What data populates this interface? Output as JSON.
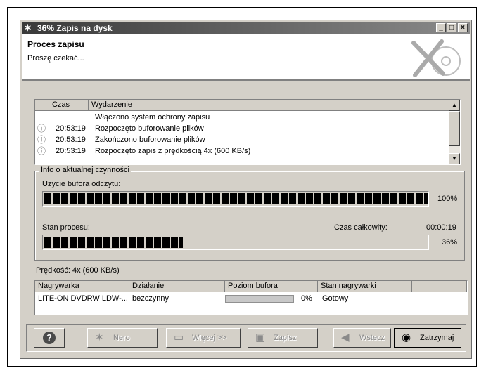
{
  "window": {
    "title": "36% Zapis na dysk",
    "buttons": {
      "minimize": "_",
      "maximize": "□",
      "close": "×"
    }
  },
  "header": {
    "heading": "Proces zapisu",
    "subtitle": "Proszę czekać..."
  },
  "log": {
    "columns": {
      "time": "Czas",
      "event": "Wydarzenie"
    },
    "rows": [
      {
        "icon": "",
        "time": "",
        "event": "Włączono system ochrony zapisu"
      },
      {
        "icon": "info-icon",
        "time": "20:53:19",
        "event": "Rozpoczęto buforowanie plików"
      },
      {
        "icon": "info-icon",
        "time": "20:53:19",
        "event": "Zakończono buforowanie plików"
      },
      {
        "icon": "info-icon",
        "time": "20:53:19",
        "event": "Rozpoczęto zapis z prędkością 4x (600 KB/s)"
      }
    ]
  },
  "activity": {
    "legend": "Info o aktualnej czynności",
    "buffer_label": "Użycie bufora odczytu:",
    "buffer_percent": "100%",
    "buffer_value": 1.0,
    "process_label": "Stan procesu:",
    "total_time_label": "Czas całkowity:",
    "total_time": "00:00:19",
    "process_percent": "36%",
    "process_value": 0.36
  },
  "speed": "Prędkość: 4x (600 KB/s)",
  "devices": {
    "columns": {
      "recorder": "Nagrywarka",
      "action": "Działanie",
      "buffer": "Poziom bufora",
      "status": "Stan nagrywarki"
    },
    "rows": [
      {
        "recorder": "LITE-ON DVDRW LDW-...",
        "action": "bezczynny",
        "buffer_percent": "0%",
        "buffer_value": 0,
        "status": "Gotowy"
      }
    ]
  },
  "buttons": {
    "help": "?",
    "nero": "Nero",
    "more": "Więcej >>",
    "save": "Zapisz",
    "back": "Wstecz",
    "stop": "Zatrzymaj"
  },
  "icons": {
    "app": "nero-app-icon",
    "help": "question-icon",
    "nero": "nero-icon",
    "more": "monitor-icon",
    "save": "floppy-disk-icon",
    "back": "back-arrow-icon",
    "stop": "stop-icon"
  }
}
